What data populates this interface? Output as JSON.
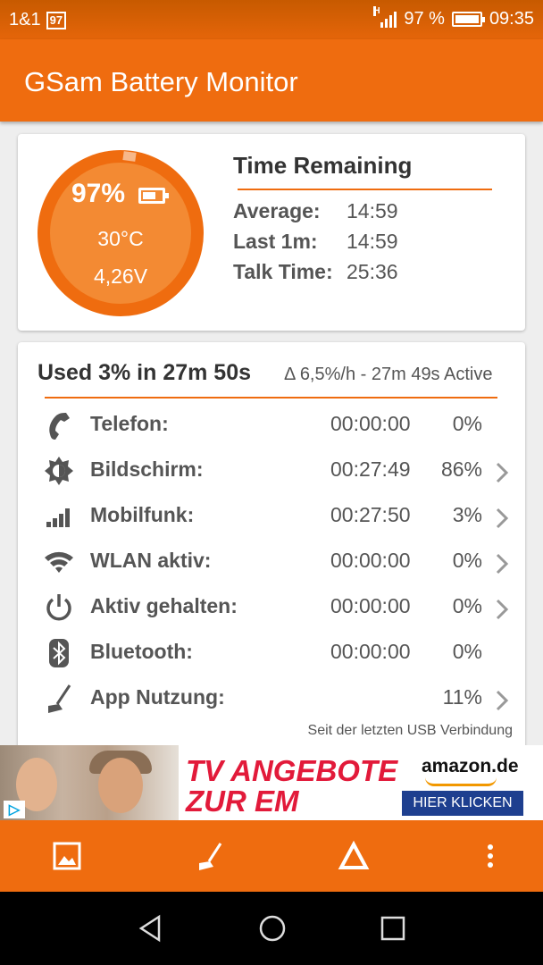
{
  "status": {
    "carrier": "1&1",
    "notif_badge": "97",
    "signal_label": "H",
    "battery_pct": "97 %",
    "time": "09:35"
  },
  "app": {
    "title": "GSam Battery Monitor"
  },
  "gauge": {
    "percent": "97%",
    "temperature": "30°C",
    "voltage": "4,26V",
    "level": 0.97
  },
  "time_remaining": {
    "title": "Time Remaining",
    "rows": [
      {
        "label": "Average:",
        "value": "14:59"
      },
      {
        "label": "Last 1m:",
        "value": "14:59"
      },
      {
        "label": "Talk Time:",
        "value": "25:36"
      }
    ]
  },
  "usage": {
    "headline": "Used 3% in 27m 50s",
    "rate": "Δ 6,5%/h - 27m 49s Active",
    "rows": [
      {
        "icon": "phone-icon",
        "label": "Telefon:",
        "time": "00:00:00",
        "percent": "0%",
        "chevron": false
      },
      {
        "icon": "brightness-icon",
        "label": "Bildschirm:",
        "time": "00:27:49",
        "percent": "86%",
        "chevron": true
      },
      {
        "icon": "signal-bars-icon",
        "label": "Mobilfunk:",
        "time": "00:27:50",
        "percent": "3%",
        "chevron": true
      },
      {
        "icon": "wifi-icon",
        "label": "WLAN aktiv:",
        "time": "00:00:00",
        "percent": "0%",
        "chevron": true
      },
      {
        "icon": "power-icon",
        "label": "Aktiv gehalten:",
        "time": "00:00:00",
        "percent": "0%",
        "chevron": true
      },
      {
        "icon": "bluetooth-icon",
        "label": "Bluetooth:",
        "time": "00:00:00",
        "percent": "0%",
        "chevron": false
      },
      {
        "icon": "broom-icon",
        "label": "App Nutzung:",
        "time": "",
        "percent": "11%",
        "chevron": true
      }
    ],
    "since": "Seit der letzten USB Verbindung"
  },
  "ad": {
    "headline_line1": "TV ANGEBOTE",
    "headline_line2": "ZUR EM",
    "brand": "amazon.de",
    "cta": "HIER KLICKEN",
    "adchoice": "▷"
  },
  "colors": {
    "accent": "#ef6c0f",
    "gauge_inner": "#f38a33",
    "ad_red": "#e21a3a",
    "ad_button": "#1e3f8f"
  }
}
